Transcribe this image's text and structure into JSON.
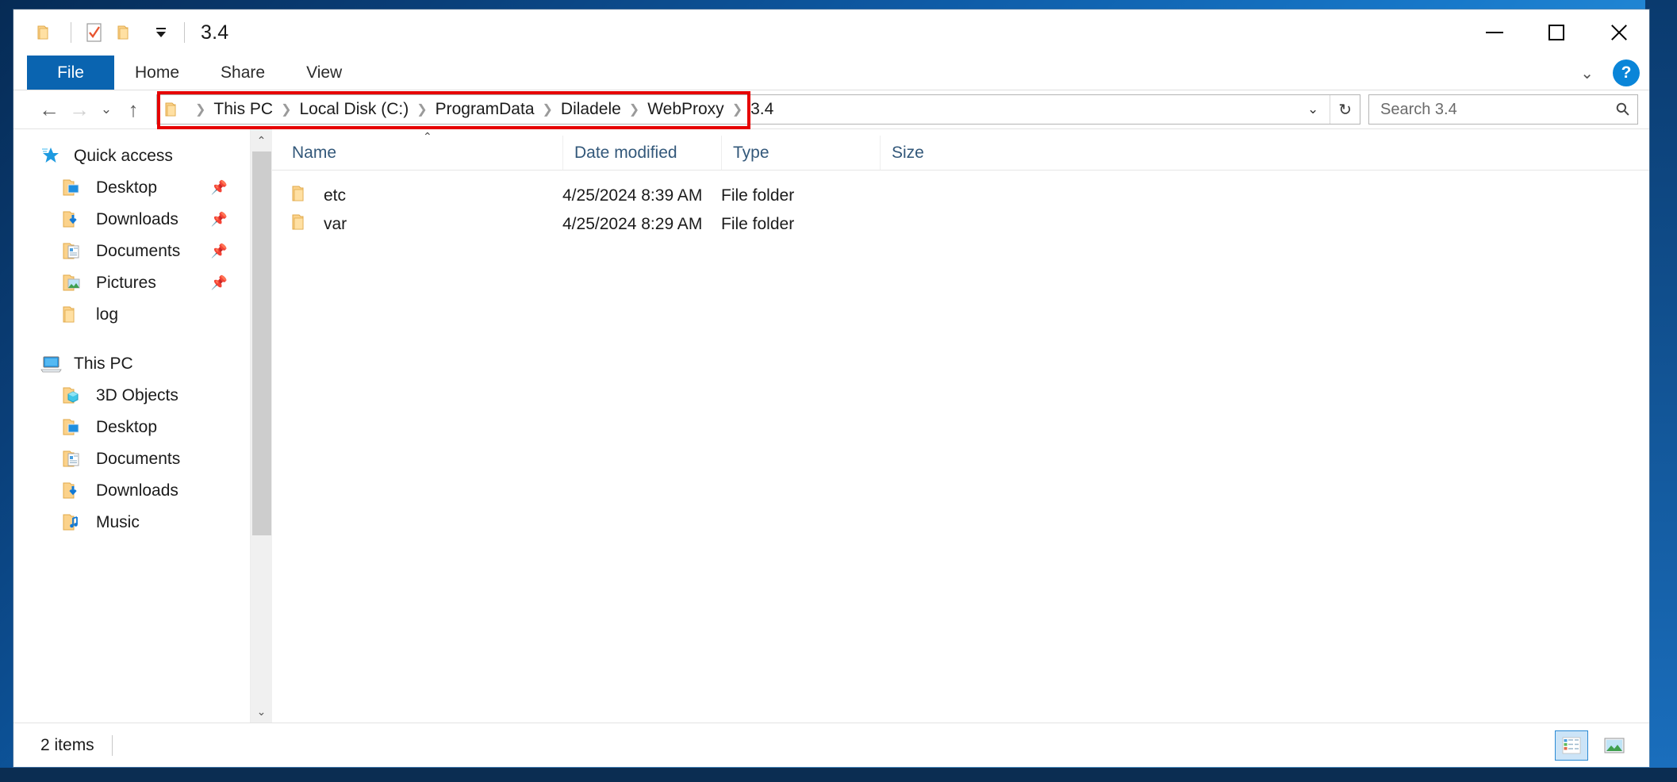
{
  "window": {
    "title": "3.4",
    "quick_access_toolbar": [
      {
        "name": "properties-folder-icon",
        "label": "Properties"
      },
      {
        "name": "new-folder-icon",
        "label": "New folder"
      },
      {
        "name": "customize-quick-access-icon",
        "label": "Customize Quick Access Toolbar"
      }
    ],
    "controls": {
      "minimize": "Minimize",
      "maximize": "Maximize",
      "close": "Close"
    }
  },
  "ribbon": {
    "tabs": [
      {
        "label": "File",
        "active": true
      },
      {
        "label": "Home",
        "active": false
      },
      {
        "label": "Share",
        "active": false
      },
      {
        "label": "View",
        "active": false
      }
    ],
    "collapse_label": "⌄",
    "help_label": "?"
  },
  "navigation": {
    "back": "←",
    "forward": "→",
    "recent": "⌄",
    "up": "↑"
  },
  "address": {
    "highlighted": true,
    "highlight_color": "#e60000",
    "crumbs": [
      "This PC",
      "Local Disk (C:)",
      "ProgramData",
      "Diladele",
      "WebProxy",
      "3.4"
    ],
    "separator": "❯",
    "dropdown": "⌄",
    "refresh": "↻"
  },
  "search": {
    "placeholder": "Search 3.4",
    "value": "",
    "icon": "search-icon"
  },
  "sidebar": {
    "groups": [
      {
        "name": "Quick access",
        "icon": "star-icon",
        "items": [
          {
            "label": "Desktop",
            "icon": "folder-desktop-icon",
            "pinned": true
          },
          {
            "label": "Downloads",
            "icon": "folder-downloads-icon",
            "pinned": true
          },
          {
            "label": "Documents",
            "icon": "folder-documents-icon",
            "pinned": true
          },
          {
            "label": "Pictures",
            "icon": "folder-pictures-icon",
            "pinned": true
          },
          {
            "label": "log",
            "icon": "folder-icon",
            "pinned": false
          }
        ]
      },
      {
        "name": "This PC",
        "icon": "this-pc-icon",
        "items": [
          {
            "label": "3D Objects",
            "icon": "folder-3dobjects-icon",
            "pinned": false
          },
          {
            "label": "Desktop",
            "icon": "folder-desktop-icon",
            "pinned": false
          },
          {
            "label": "Documents",
            "icon": "folder-documents-icon",
            "pinned": false
          },
          {
            "label": "Downloads",
            "icon": "folder-downloads-icon",
            "pinned": false
          },
          {
            "label": "Music",
            "icon": "folder-music-icon",
            "pinned": false
          }
        ]
      }
    ],
    "pin_glyph": "📌",
    "scroll_up": "⌃",
    "scroll_down": "⌄"
  },
  "filelist": {
    "columns": [
      {
        "label": "Name",
        "sorted": "asc"
      },
      {
        "label": "Date modified",
        "sorted": null
      },
      {
        "label": "Type",
        "sorted": null
      },
      {
        "label": "Size",
        "sorted": null
      }
    ],
    "sort_indicator": "⌃",
    "rows": [
      {
        "name": "etc",
        "date_modified": "4/25/2024 8:39 AM",
        "type": "File folder",
        "size": "",
        "icon": "folder-icon"
      },
      {
        "name": "var",
        "date_modified": "4/25/2024 8:29 AM",
        "type": "File folder",
        "size": "",
        "icon": "folder-icon"
      }
    ]
  },
  "statusbar": {
    "item_count": "2 items",
    "views": [
      {
        "name": "details-view-button",
        "label": "Details view",
        "active": true
      },
      {
        "name": "large-icons-view-button",
        "label": "Large icons view",
        "active": false
      }
    ]
  },
  "colors": {
    "accent": "#0a64b0",
    "highlight": "#e60000",
    "header_text": "#33587a",
    "folder": "#ffd782"
  }
}
